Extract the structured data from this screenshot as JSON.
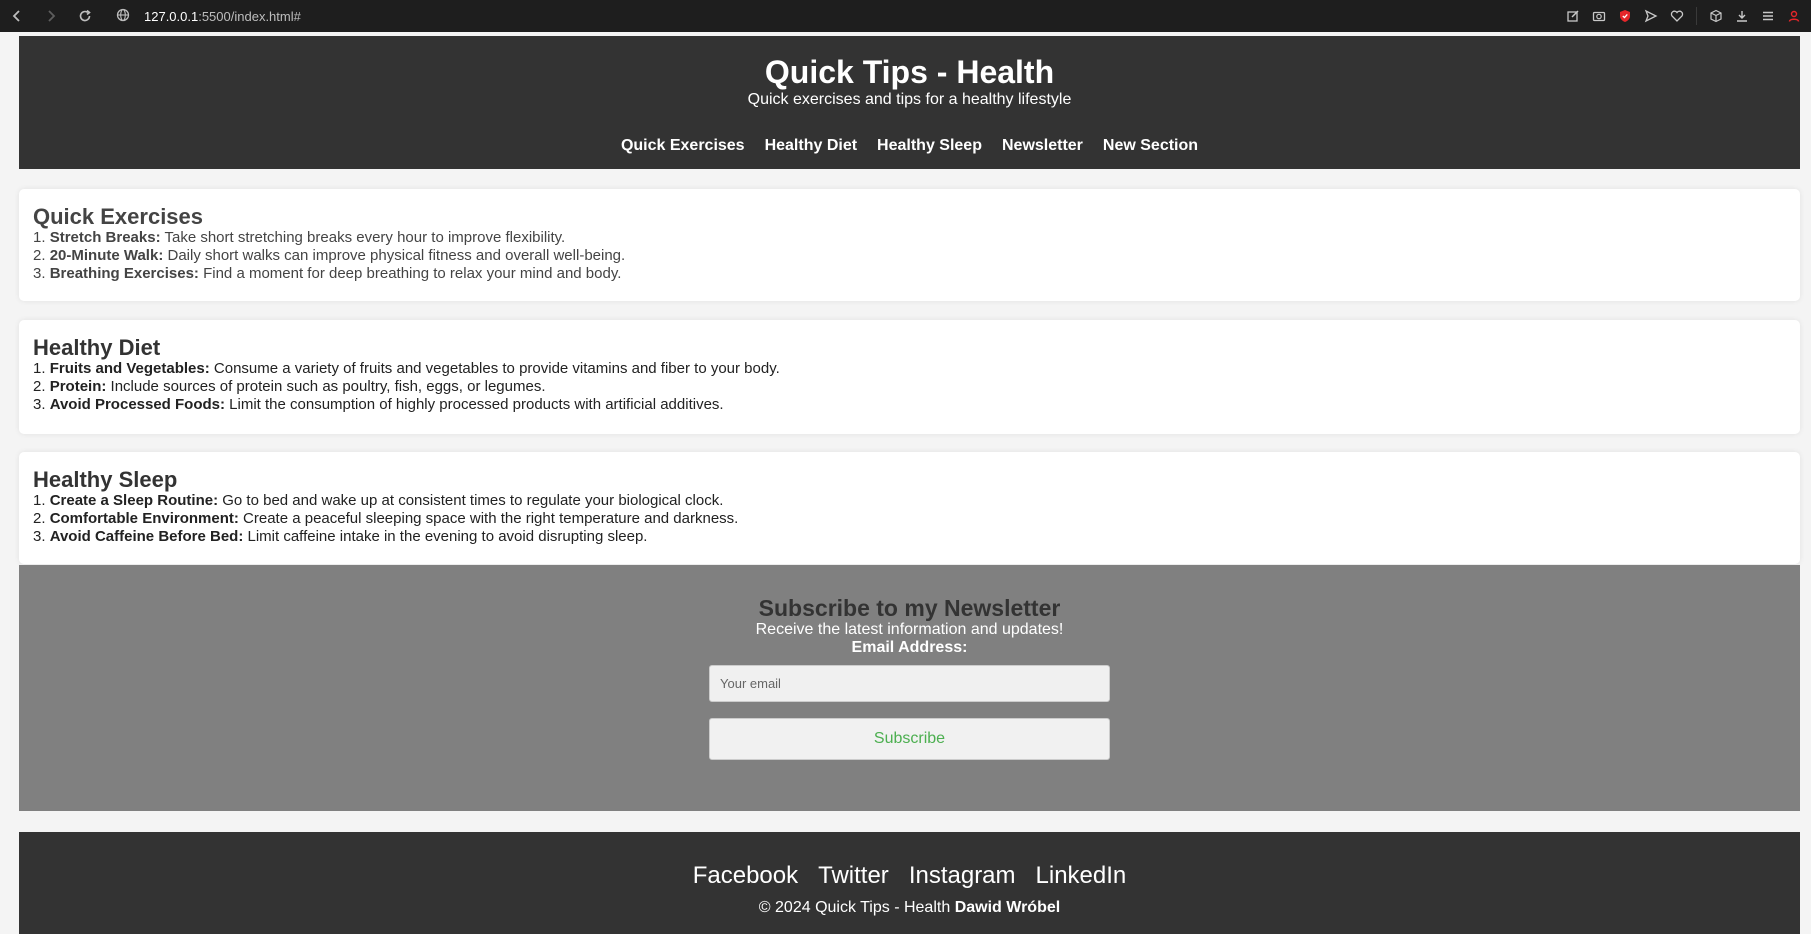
{
  "browser": {
    "url_host": "127.0.0.1",
    "url_path": ":5500/index.html#"
  },
  "header": {
    "title": "Quick Tips - Health",
    "subtitle": "Quick exercises and tips for a healthy lifestyle",
    "nav": [
      "Quick Exercises",
      "Healthy Diet",
      "Healthy Sleep",
      "Newsletter",
      "New Section"
    ]
  },
  "sections": {
    "exercises": {
      "title": "Quick Exercises",
      "items": [
        {
          "num": "1.",
          "label": "Stretch Breaks:",
          "text": "Take short stretching breaks every hour to improve flexibility."
        },
        {
          "num": "2.",
          "label": "20-Minute Walk:",
          "text": "Daily short walks can improve physical fitness and overall well-being."
        },
        {
          "num": "3.",
          "label": "Breathing Exercises:",
          "text": "Find a moment for deep breathing to relax your mind and body."
        }
      ]
    },
    "diet": {
      "title": "Healthy Diet",
      "items": [
        {
          "num": "1.",
          "label": "Fruits and Vegetables:",
          "text": "Consume a variety of fruits and vegetables to provide vitamins and fiber to your body."
        },
        {
          "num": "2.",
          "label": "Protein:",
          "text": "Include sources of protein such as poultry, fish, eggs, or legumes."
        },
        {
          "num": "3.",
          "label": "Avoid Processed Foods:",
          "text": "Limit the consumption of highly processed products with artificial additives."
        }
      ]
    },
    "sleep": {
      "title": "Healthy Sleep",
      "items": [
        {
          "num": "1.",
          "label": "Create a Sleep Routine:",
          "text": "Go to bed and wake up at consistent times to regulate your biological clock."
        },
        {
          "num": "2.",
          "label": "Comfortable Environment:",
          "text": "Create a peaceful sleeping space with the right temperature and darkness."
        },
        {
          "num": "3.",
          "label": "Avoid Caffeine Before Bed:",
          "text": "Limit caffeine intake in the evening to avoid disrupting sleep."
        }
      ]
    }
  },
  "newsletter": {
    "title": "Subscribe to my Newsletter",
    "subtitle": "Receive the latest information and updates!",
    "email_label": "Email Address:",
    "email_placeholder": "Your email",
    "email_value": "",
    "button_label": "Subscribe"
  },
  "footer": {
    "social": [
      "Facebook",
      "Twitter",
      "Instagram",
      "LinkedIn"
    ],
    "copyright": "© 2024 Quick Tips - Health",
    "author": "Dawid Wróbel"
  },
  "colors": {
    "header_bg": "#333333",
    "newsletter_bg": "#808080",
    "subscribe_text": "#4caf50"
  }
}
